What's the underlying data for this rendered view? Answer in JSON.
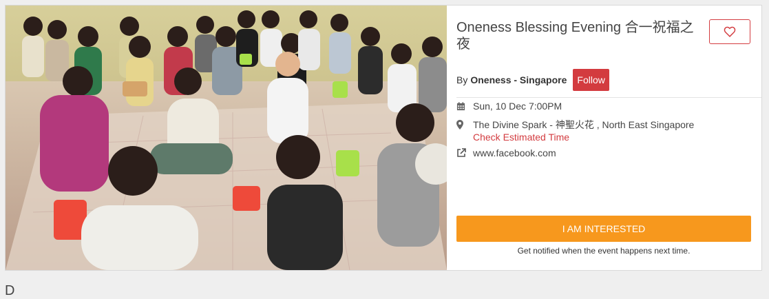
{
  "event": {
    "title": "Oneness Blessing Evening 合一祝福之夜",
    "by_prefix": "By",
    "organizer": "Oneness - Singapore",
    "follow_label": "Follow",
    "date": "Sun, 10 Dec 7:00PM",
    "location": "The Divine Spark - 神聖火花 , North East Singapore",
    "estimate_link": "Check Estimated Time",
    "website": "www.facebook.com",
    "cta_label": "I AM INTERESTED",
    "cta_note": "Get notified when the event happens next time."
  },
  "below_label": "D",
  "icons": {
    "like": "heart-icon",
    "date": "calendar-icon",
    "location": "map-marker-icon",
    "website": "external-link-icon"
  },
  "colors": {
    "accent_red": "#d33b3f",
    "cta_orange": "#f7981d"
  }
}
